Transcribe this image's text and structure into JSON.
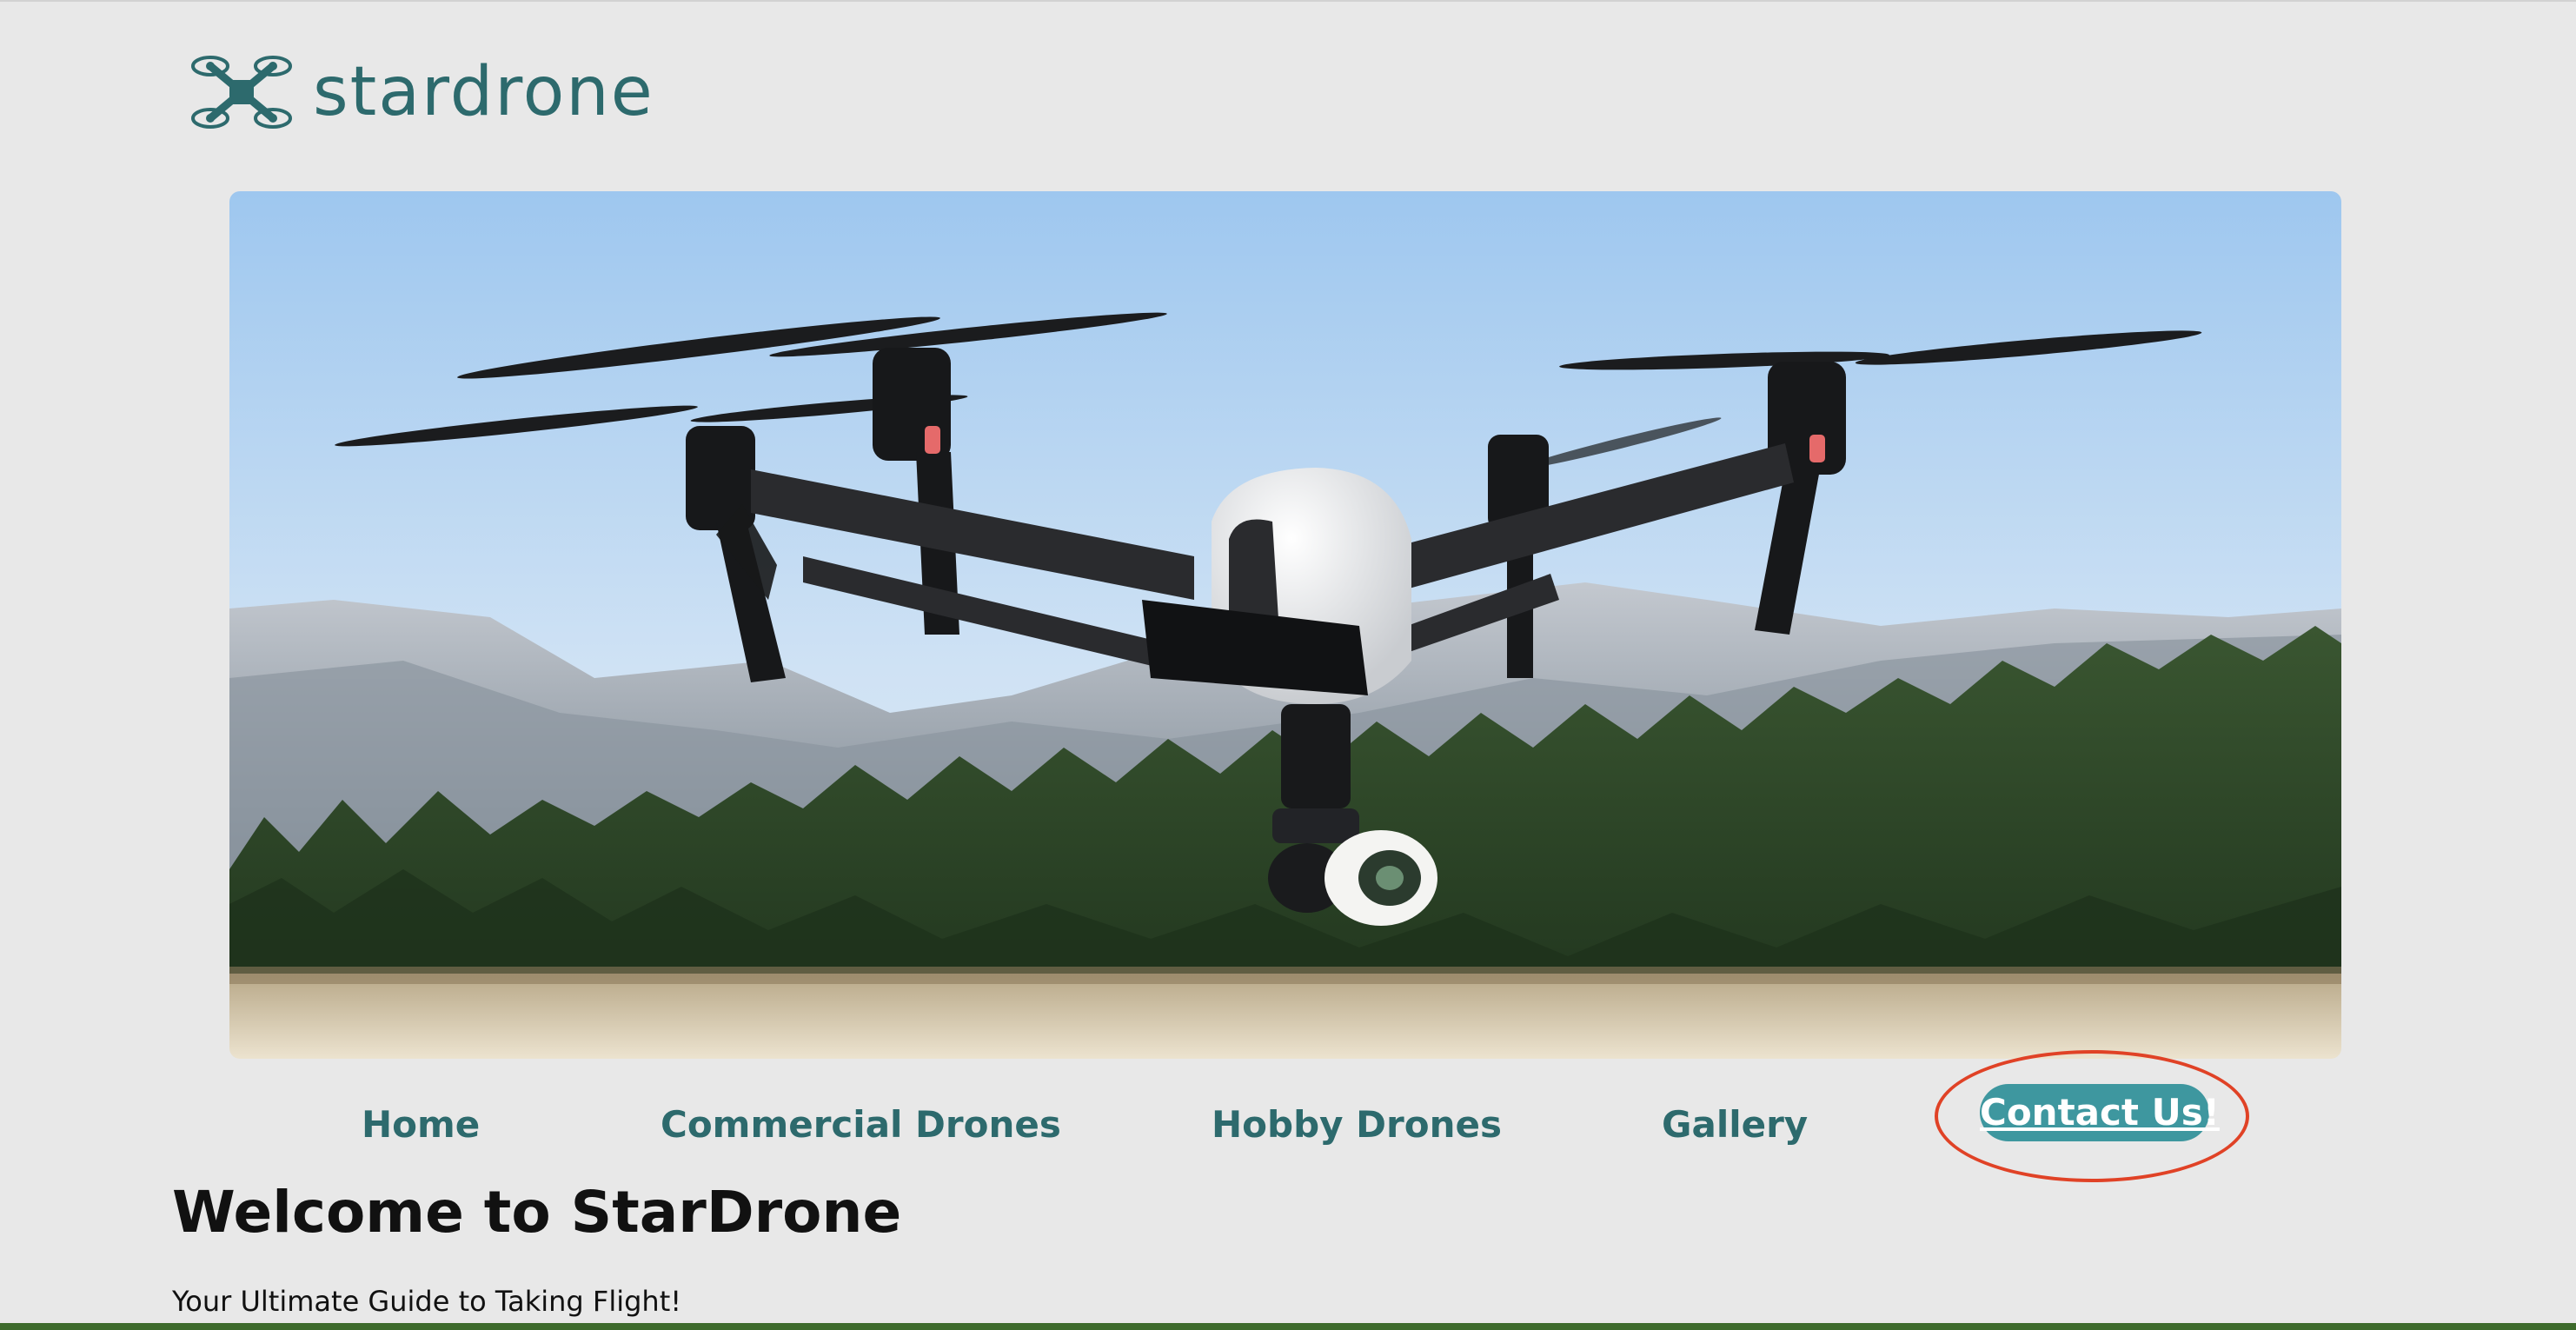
{
  "logo": {
    "text": "stardrone",
    "icon": "quadcopter-icon",
    "color": "#2d6a6d"
  },
  "hero": {
    "image": "drone-over-mountains-photo",
    "sky_color": "#a9cdf0",
    "forest_color": "#2f4a2a"
  },
  "nav": {
    "items": [
      {
        "label": "Home"
      },
      {
        "label": "Commercial Drones"
      },
      {
        "label": "Hobby Drones"
      },
      {
        "label": "Gallery"
      }
    ],
    "link_color": "#2d6a6d",
    "contact": {
      "label": "Contact Us!",
      "background": "#3e979f",
      "highlight_color": "#e04226"
    }
  },
  "content": {
    "title": "Welcome to StarDrone",
    "tagline": "Your Ultimate Guide to Taking Flight!"
  }
}
